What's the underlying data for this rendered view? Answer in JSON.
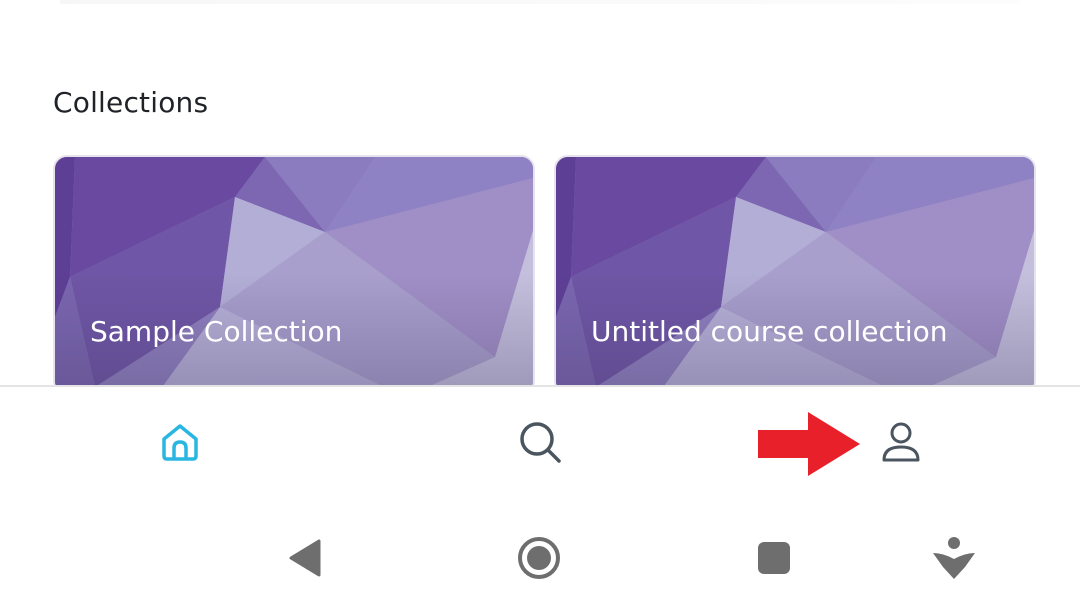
{
  "section": {
    "title": "Collections"
  },
  "collections": [
    {
      "title": "Sample Collection"
    },
    {
      "title": "Untitled course collection"
    }
  ],
  "bottom_nav": {
    "items": [
      {
        "name": "home",
        "icon": "home-icon",
        "active": true
      },
      {
        "name": "search",
        "icon": "search-icon",
        "active": false
      },
      {
        "name": "profile",
        "icon": "person-icon",
        "active": false
      }
    ],
    "active_color": "#29b6e0",
    "inactive_color": "#4a5560"
  },
  "system_nav": {
    "buttons": [
      "back-icon",
      "home-circle-icon",
      "recents-icon",
      "accessibility-icon"
    ],
    "color": "#6e6e6e"
  },
  "annotation": {
    "icon": "red-arrow-right-icon",
    "color": "#e8202a"
  }
}
